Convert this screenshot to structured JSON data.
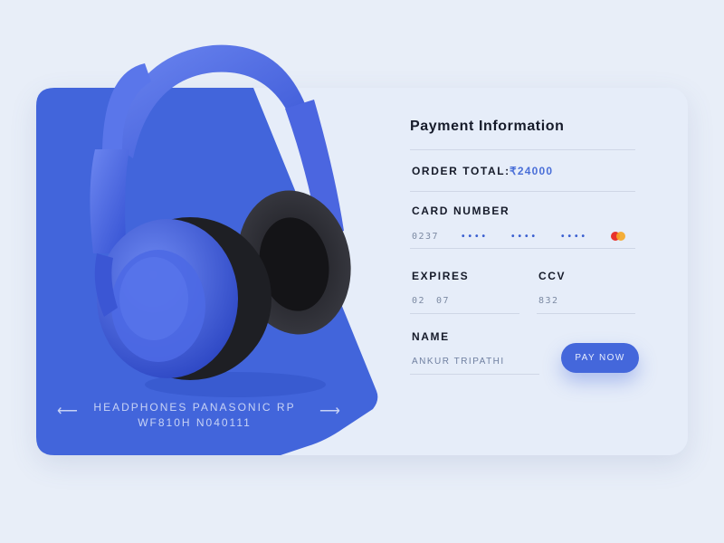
{
  "product": {
    "name_line1": "HEADPHONES PANASONIC RP",
    "name_line2": "WF810H N040111",
    "prev_icon": "arrow-left-icon",
    "next_icon": "arrow-right-icon",
    "image": "headphones-image"
  },
  "payment": {
    "title": "Payment Information",
    "order_total_label": "ORDER TOTAL:",
    "order_total_value": "₹24000",
    "card_number_label": "CARD NUMBER",
    "card_first": "0237",
    "card_masked": [
      "••••",
      "••••",
      "••••"
    ],
    "card_brand_icon": "mastercard-icon",
    "expires_label": "EXPIRES",
    "expires_month": "02",
    "expires_year": "07",
    "ccv_label": "CCV",
    "ccv_value": "832",
    "name_label": "NAME",
    "name_value": "ANKUR TRIPATHI",
    "pay_button": "PAY NOW"
  },
  "colors": {
    "accent": "#4467db",
    "background": "#e8eef8",
    "card": "#e6edf9"
  }
}
